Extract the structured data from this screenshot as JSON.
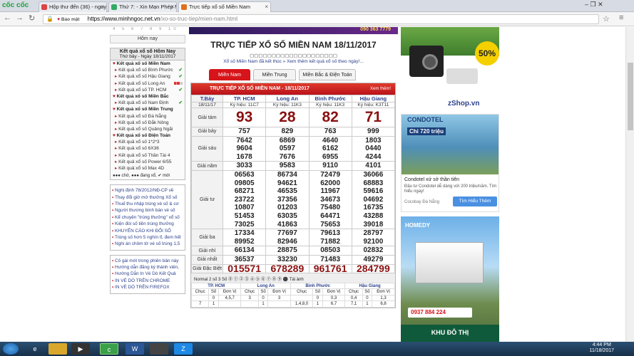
{
  "browser": {
    "brand": "cốc cốc",
    "tabs": [
      {
        "label": "Hộp thư đến (36) - nguyễ",
        "active": false,
        "color": "#d44"
      },
      {
        "label": "Thứ 7: - Xin Mạn Phép M",
        "active": false,
        "color": "#3a6"
      },
      {
        "label": "Trực tiếp xổ số Miền Nam",
        "active": true,
        "color": "#e07020"
      }
    ],
    "secure_label": "Bảo mật",
    "url_host": "https://www.minhngoc.net.vn",
    "url_path": "/xo-so-truc-tiep/mien-nam.html",
    "win_controls": "–  ❐  ✕"
  },
  "left": {
    "calendar": "4  5  6  7  8  9  10",
    "today_button": "Hôm nay",
    "box_title": "Kết quả xổ số Hôm Nay",
    "box_date": "Thứ bảy - Ngày 18/11/2017",
    "items": [
      {
        "t": "sec",
        "label": "Kết quả xổ số Miền Nam"
      },
      {
        "t": "itm",
        "label": "Kết quả xổ số Bình Phước",
        "m": "ok"
      },
      {
        "t": "itm",
        "label": "Kết quả xổ số Hậu Giang",
        "m": "ok"
      },
      {
        "t": "itm",
        "label": "Kết quả xổ số Long An",
        "m": "dots"
      },
      {
        "t": "itm",
        "label": "Kết quả xổ số TP. HCM",
        "m": "ok"
      },
      {
        "t": "sec",
        "label": "Kết quả xổ số Miền Bắc"
      },
      {
        "t": "itm",
        "label": "Kết quả xổ số Nam Định",
        "m": "ok"
      },
      {
        "t": "sec",
        "label": "Kết quả xổ số Miền Trung"
      },
      {
        "t": "itm",
        "label": "Kết quả xổ số Đà Nẵng",
        "m": ""
      },
      {
        "t": "itm",
        "label": "Kết quả xổ số Đắk Nông",
        "m": ""
      },
      {
        "t": "itm",
        "label": "Kết quả xổ số Quảng Ngãi",
        "m": ""
      },
      {
        "t": "sec",
        "label": "Kết quả xổ số Điện Toán"
      },
      {
        "t": "itm",
        "label": "Kết quả xổ số 1*2*3",
        "m": ""
      },
      {
        "t": "itm",
        "label": "Kết quả xổ số 6X36",
        "m": ""
      },
      {
        "t": "itm",
        "label": "Kết quả xổ số Thần Tài 4",
        "m": ""
      },
      {
        "t": "itm",
        "label": "Kết quả xổ số Power 6/55",
        "m": ""
      },
      {
        "t": "itm",
        "label": "Kết quả xổ số Max 4D",
        "m": ""
      }
    ],
    "legend": "●●● chờ, ●●● đang xổ, ✔ mới",
    "news1": [
      "Nghị định 78/2012/NĐ-CP về",
      "Thay đổi giờ mở thưởng Xổ số",
      "Thuế thu nhập trúng vé số & cơ",
      "Người thương bình bán vé số",
      "Kể chuyện \"trúng thưởng\" xổ số",
      "Kiện đòi số tiền trúng thưởng",
      "KHUYẾN CÁO KHI ĐỔI SỐ",
      "Trúng số hơn 5 nghìn tỉ, đem hết",
      "Nghi án chôm tờ vé số trúng 1,5"
    ],
    "news2": [
      "Cô gái mới trong phiên bản này",
      "Hướng dẫn đăng ký thành viên,",
      "Hướng Dẫn In Vé Dò Kết Quả",
      "IN VÉ DÒ TRÊN CHROME",
      "IN VÉ DÒ TRÊN FIREFOX"
    ]
  },
  "main": {
    "banner_phone": "090 363 7779",
    "title": "TRỰC TIẾP XỔ SỐ MIỀN NAM 18/11/2017",
    "subtitle": "▢▢▢▢▢▢▢▢▢▢▢▢▢▢▢▢▢▢▢▢",
    "notice": "Xổ số Miền Nam đã kết thúc » Xem thêm kết quả xổ số theo ngày!...",
    "region_tabs": [
      "Miền Nam",
      "Miền Trung",
      "Miền Bắc & Điện Toán"
    ],
    "table_title": "TRỰC TIẾP XỔ SỐ MIỀN NAM - 18/11/2017",
    "more": "Xem thêm!",
    "day": "T.Bảy",
    "date": "18/11/17",
    "provinces": [
      {
        "name": "TP. HCM",
        "code": "Ký hiệu: 11C7"
      },
      {
        "name": "Long An",
        "code": "Ký hiệu: 11K3"
      },
      {
        "name": "Bình Phước",
        "code": "Ký hiệu: 11K3"
      },
      {
        "name": "Hậu Giang",
        "code": "Ký hiệu: K3T11"
      }
    ],
    "prizes": [
      {
        "label": "Giải tám",
        "cls": "g8",
        "vals": [
          [
            "93"
          ],
          [
            "28"
          ],
          [
            "82"
          ],
          [
            "71"
          ]
        ]
      },
      {
        "label": "Giải bảy",
        "cls": "",
        "vals": [
          [
            "757"
          ],
          [
            "829"
          ],
          [
            "763"
          ],
          [
            "999"
          ]
        ]
      },
      {
        "label": "Giải sáu",
        "cls": "",
        "vals": [
          [
            "7642",
            "9604",
            "1678"
          ],
          [
            "6869",
            "0597",
            "7676"
          ],
          [
            "4640",
            "6162",
            "6955"
          ],
          [
            "1803",
            "0440",
            "4244"
          ]
        ]
      },
      {
        "label": "Giải năm",
        "cls": "",
        "vals": [
          [
            "3033"
          ],
          [
            "9583"
          ],
          [
            "9110"
          ],
          [
            "4101"
          ]
        ]
      },
      {
        "label": "Giải tư",
        "cls": "",
        "vals": [
          [
            "06563",
            "09805",
            "68271",
            "23722",
            "10807",
            "51453",
            "73025"
          ],
          [
            "86734",
            "94621",
            "46535",
            "37356",
            "01203",
            "63035",
            "41863"
          ],
          [
            "72479",
            "62000",
            "11967",
            "34673",
            "75480",
            "64471",
            "75653"
          ],
          [
            "36066",
            "68883",
            "59616",
            "04692",
            "16735",
            "43288",
            "39018"
          ]
        ]
      },
      {
        "label": "Giải ba",
        "cls": "",
        "vals": [
          [
            "17334",
            "89952"
          ],
          [
            "77697",
            "82946"
          ],
          [
            "79613",
            "71882"
          ],
          [
            "28797",
            "92100"
          ]
        ]
      },
      {
        "label": "Giải nhì",
        "cls": "",
        "vals": [
          [
            "66134"
          ],
          [
            "28875"
          ],
          [
            "08503"
          ],
          [
            "02832"
          ]
        ]
      },
      {
        "label": "Giải nhất",
        "cls": "",
        "vals": [
          [
            "36537"
          ],
          [
            "33230"
          ],
          [
            "71483"
          ],
          [
            "49279"
          ]
        ]
      },
      {
        "label": "Giải Đặc Biệt",
        "cls": "db",
        "vals": [
          [
            "015571"
          ],
          [
            "678289"
          ],
          [
            "961761"
          ],
          [
            "284799"
          ]
        ]
      }
    ],
    "controls": "Normal   2 số   3 Số   ⓪ ① ② ③ ④ ⑤ ⑥ ⑦ ⑧ ⑨   ⚫ Tải ảnh",
    "loto_heads": [
      "TP. HCM",
      "Long An",
      "Bình Phước",
      "Hậu Giang"
    ],
    "loto_sub": [
      "Chục",
      "Số",
      "Đơn Vị"
    ],
    "loto_rows": [
      [
        "",
        "0",
        "4,5,7",
        "3",
        "0",
        "3",
        "",
        "0",
        "0,3",
        "0,4",
        "0",
        "1,3"
      ],
      [
        "7",
        "1",
        "",
        "",
        "1",
        "",
        "1,4,8,0",
        "1",
        "6,7",
        "7,1",
        "1",
        "6,8"
      ]
    ]
  },
  "ads": {
    "zshop": "zShop.vn",
    "percent": "50%",
    "condotel_brand": "CONDOTEL",
    "condotel_price": "Chỉ 720 triệu",
    "condotel_title": "Condotel xứ sở thần tiên",
    "condotel_desc": "Đầu tư Condotel dễ dàng với 200 triệu/năm. Tìm hiểu ngay!",
    "condotel_src": "Cocobay Đà Nẵng",
    "condotel_btn": "Tìm Hiểu Thêm",
    "homedy": "HOMEDY",
    "phone": "0937 884 224",
    "khu": "KHU ĐÔ THỊ"
  },
  "taskbar": {
    "time": "4:44 PM",
    "date": "11/18/2017"
  },
  "colors": {
    "accent_red": "#d7141a",
    "winner_red": "#8a1010",
    "link_blue": "#2b3f8c"
  }
}
